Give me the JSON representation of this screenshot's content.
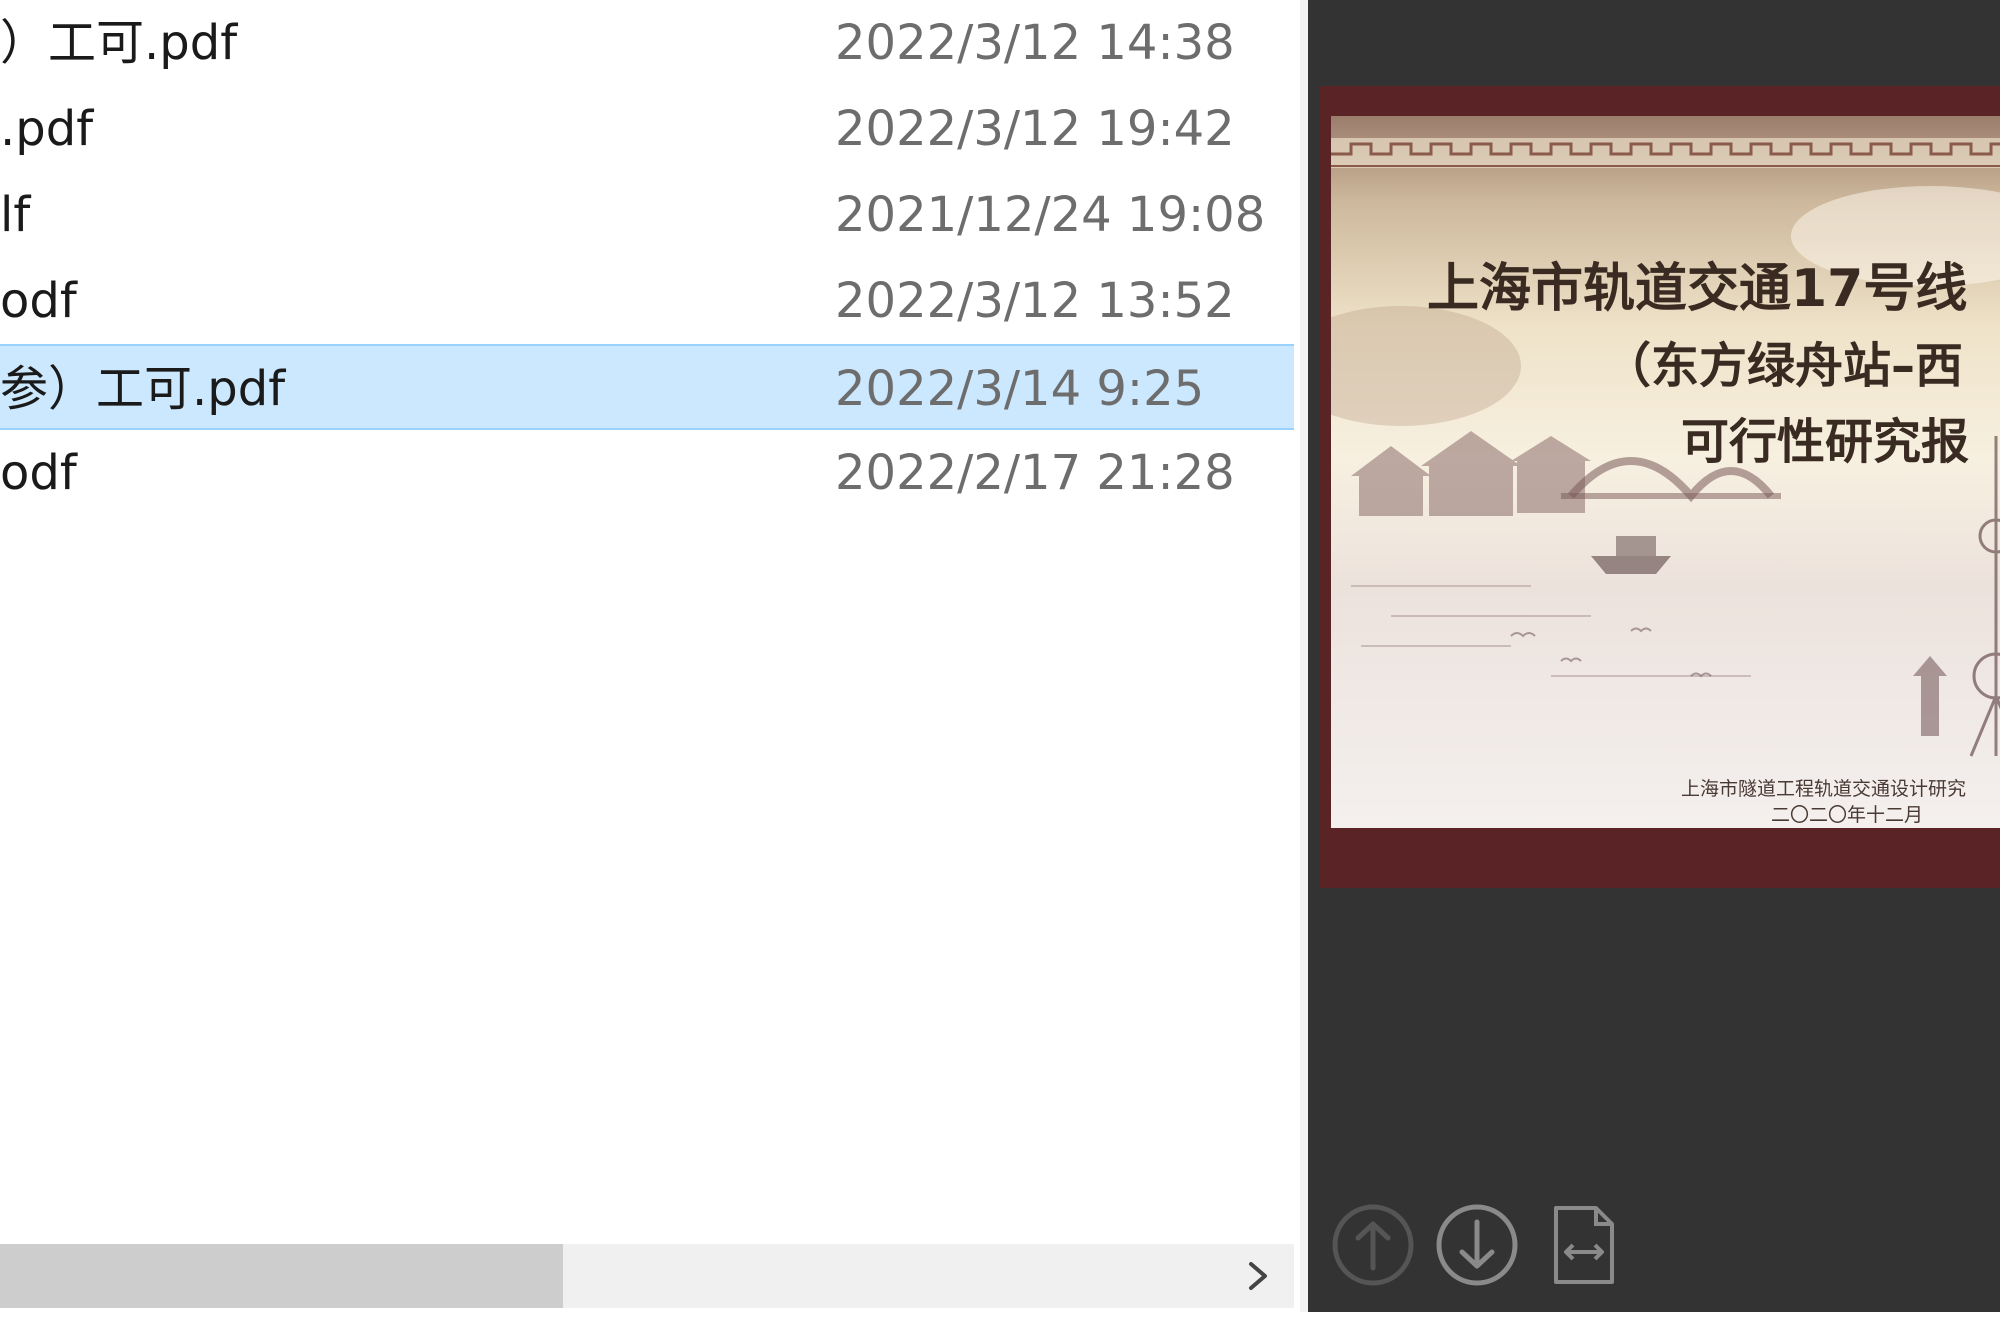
{
  "file_list": {
    "rows": [
      {
        "name": "）工可.pdf",
        "date": "2022/3/12 14:38",
        "selected": false
      },
      {
        "name": ".pdf",
        "date": "2022/3/12 19:42",
        "selected": false
      },
      {
        "name": "lf",
        "date": "2021/12/24 19:08",
        "selected": false
      },
      {
        "name": "odf",
        "date": "2022/3/12 13:52",
        "selected": false
      },
      {
        "name": "参）工可.pdf",
        "date": "2022/3/14 9:25",
        "selected": true
      },
      {
        "name": "odf",
        "date": "2022/2/17 21:28",
        "selected": false
      }
    ],
    "scrollbar": {
      "position_fraction": 0.0,
      "visible_fraction": 0.46
    }
  },
  "preview": {
    "title_line_1": "上海市轨道交通17号线",
    "title_line_2": "（东方绿舟站–西",
    "title_line_3": "可行性研究报",
    "organization": "上海市隧道工程轨道交通设计研究",
    "date": "二〇二〇年十二月",
    "toolbar": {
      "prev_icon": "arrow-up-circle-icon",
      "next_icon": "arrow-down-circle-icon",
      "fit_icon": "fit-width-page-icon"
    }
  },
  "colors": {
    "selection_bg": "#cce8ff",
    "selection_border": "#99d1ff",
    "preview_bg": "#333333",
    "doc_border": "#5a2426"
  }
}
